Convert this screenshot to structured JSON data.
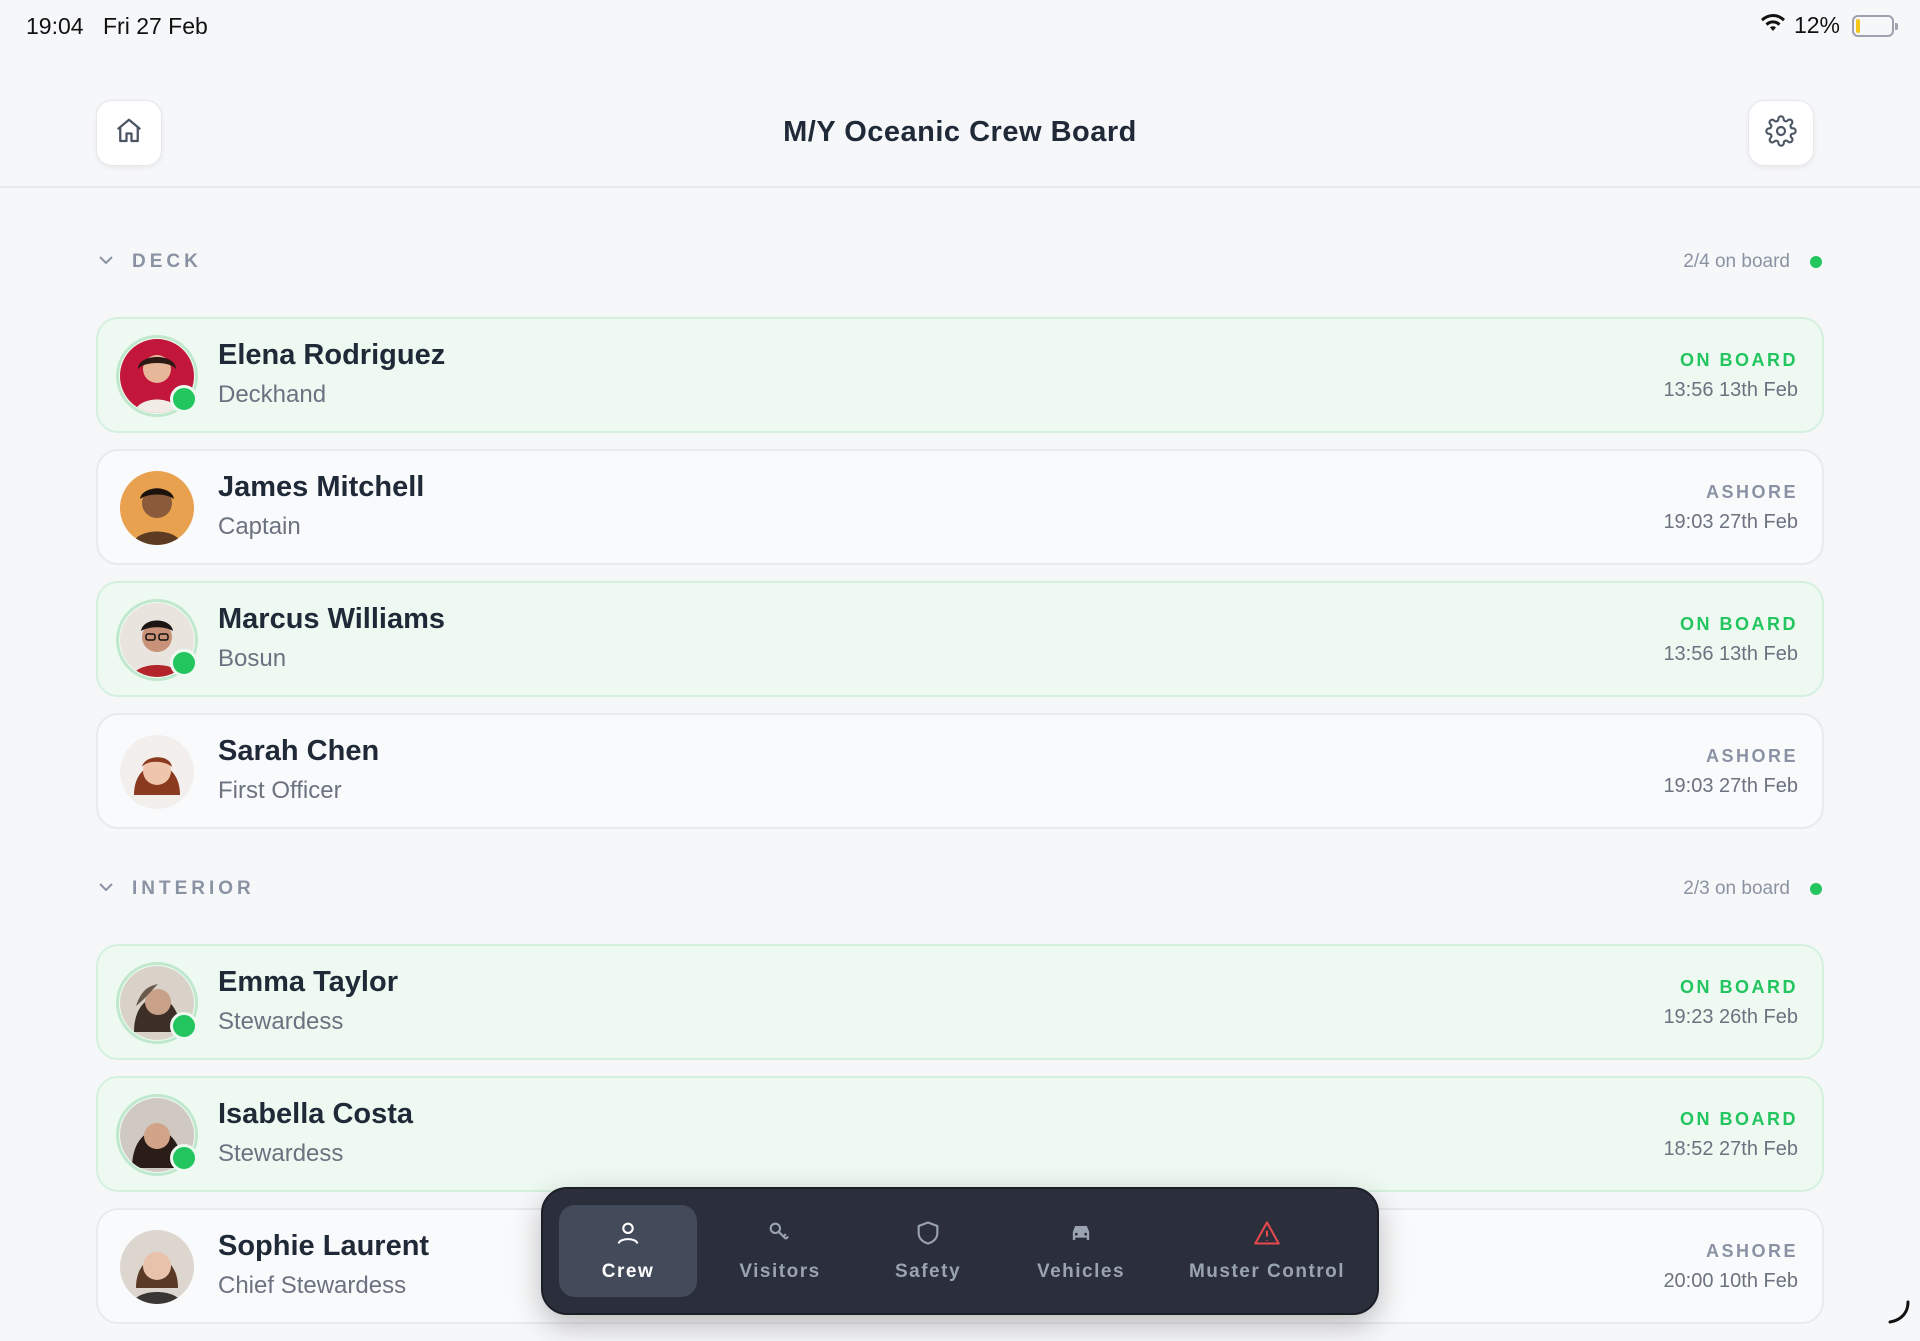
{
  "status_bar": {
    "time": "19:04",
    "date": "Fri 27 Feb",
    "battery_percent": "12%",
    "battery_level": 0.12
  },
  "header": {
    "title": "M/Y Oceanic Crew Board",
    "home_icon": "home-icon",
    "settings_icon": "gear-icon"
  },
  "colors": {
    "onboard": "#22c55e",
    "ashore": "#8a93a3",
    "nav_bg": "#2b2f3b",
    "danger": "#e5484d"
  },
  "sections": [
    {
      "title": "DECK",
      "count": "2/4 on board",
      "crew": [
        {
          "name": "Elena Rodriguez",
          "role": "Deckhand",
          "status": "ON BOARD",
          "time": "13:56 13th Feb"
        },
        {
          "name": "James Mitchell",
          "role": "Captain",
          "status": "ASHORE",
          "time": "19:03 27th Feb"
        },
        {
          "name": "Marcus Williams",
          "role": "Bosun",
          "status": "ON BOARD",
          "time": "13:56 13th Feb"
        },
        {
          "name": "Sarah Chen",
          "role": "First Officer",
          "status": "ASHORE",
          "time": "19:03 27th Feb"
        }
      ]
    },
    {
      "title": "INTERIOR",
      "count": "2/3 on board",
      "crew": [
        {
          "name": "Emma Taylor",
          "role": "Stewardess",
          "status": "ON BOARD",
          "time": "19:23 26th Feb"
        },
        {
          "name": "Isabella Costa",
          "role": "Stewardess",
          "status": "ON BOARD",
          "time": "18:52 27th Feb"
        },
        {
          "name": "Sophie Laurent",
          "role": "Chief Stewardess",
          "status": "ASHORE",
          "time": "20:00 10th Feb"
        }
      ]
    }
  ],
  "bottom_nav": [
    {
      "label": "Crew",
      "icon": "person-icon",
      "active": true
    },
    {
      "label": "Visitors",
      "icon": "key-icon",
      "active": false
    },
    {
      "label": "Safety",
      "icon": "shield-icon",
      "active": false
    },
    {
      "label": "Vehicles",
      "icon": "car-icon",
      "active": false
    },
    {
      "label": "Muster Control",
      "icon": "warning-icon",
      "active": false
    }
  ]
}
